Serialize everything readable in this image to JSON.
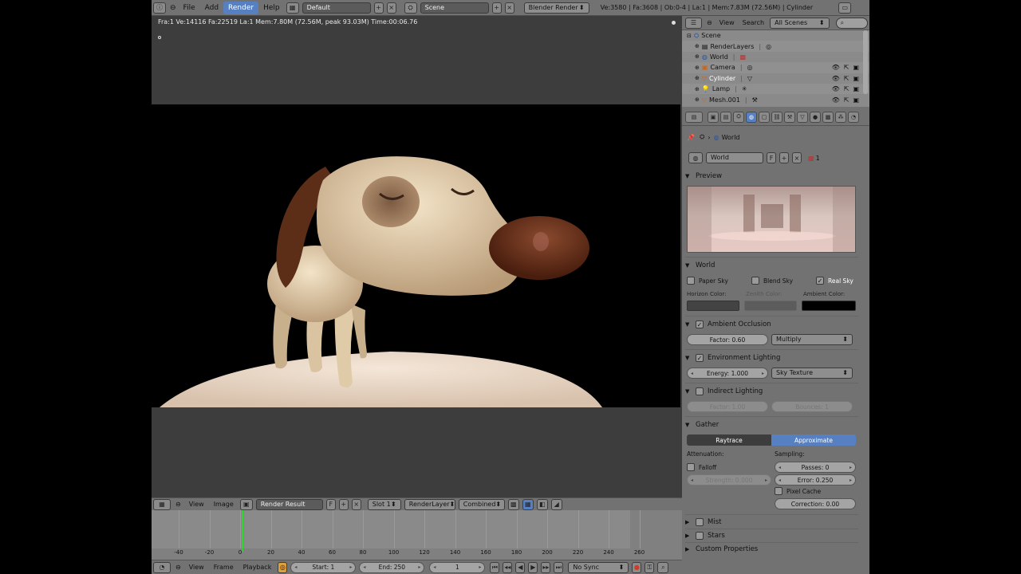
{
  "menu": {
    "file": "File",
    "add": "Add",
    "render": "Render",
    "help": "Help"
  },
  "screen_layout": "Default",
  "scene_name": "Scene",
  "render_engine": "Blender Render",
  "top_stats": "Ve:3580 | Fa:3608 | Ob:0-4 | La:1 | Mem:7.83M (72.56M) | Cylinder",
  "render_info": "Fra:1  Ve:14116 Fa:22519 La:1 Mem:7.80M (72.56M, peak 93.03M) Time:00:06.76",
  "image_header": {
    "view": "View",
    "image": "Image",
    "image_name": "Render Result",
    "fake_user": "F",
    "slot": "Slot 1",
    "layer": "RenderLayer",
    "pass": "Combined"
  },
  "timeline": {
    "ticks": [
      "-40",
      "-20",
      "0",
      "20",
      "40",
      "60",
      "80",
      "100",
      "120",
      "140",
      "160",
      "180",
      "200",
      "220",
      "240",
      "260"
    ],
    "current_frame_marker": 0,
    "view": "View",
    "frame": "Frame",
    "playback": "Playback",
    "start": "Start: 1",
    "end": "End: 250",
    "current": "1",
    "sync": "No Sync"
  },
  "outliner": {
    "view": "View",
    "search": "Search",
    "filter": "All Scenes",
    "rows": [
      {
        "label": "Scene",
        "icon": "scene-icon"
      },
      {
        "label": "RenderLayers",
        "icon": "renderlayers-icon"
      },
      {
        "label": "World",
        "icon": "world-icon"
      },
      {
        "label": "Camera",
        "icon": "camera-icon"
      },
      {
        "label": "Cylinder",
        "icon": "mesh-icon"
      },
      {
        "label": "Lamp",
        "icon": "lamp-icon"
      },
      {
        "label": "Mesh.001",
        "icon": "mesh-icon"
      }
    ]
  },
  "properties": {
    "breadcrumb": "World",
    "world_name": "World",
    "world_fake": "F",
    "world_users": "1",
    "preview_title": "Preview",
    "world_panel": {
      "title": "World",
      "paper_sky": "Paper Sky",
      "blend_sky": "Blend Sky",
      "real_sky": "Real Sky",
      "real_sky_checked": true,
      "horizon_label": "Horizon Color:",
      "zenith_label": "Zenith Color:",
      "ambient_label": "Ambient Color:",
      "horizon_color": "#434343",
      "zenith_color": "#5c5c5c",
      "ambient_color": "#000000"
    },
    "ao": {
      "title": "Ambient Occlusion",
      "factor": "Factor: 0.60",
      "blend": "Multiply"
    },
    "env": {
      "title": "Environment Lighting",
      "energy": "Energy: 1.000",
      "source": "Sky Texture"
    },
    "indirect": {
      "title": "Indirect Lighting",
      "factor": "Factor: 1.00",
      "bounces": "Bounces: 1"
    },
    "gather": {
      "title": "Gather",
      "raytrace": "Raytrace",
      "approximate": "Approximate",
      "attenuation": "Attenuation:",
      "sampling": "Sampling:",
      "falloff": "Falloff",
      "strength": "Strength: 0.000",
      "passes": "Passes: 0",
      "error": "Error: 0.250",
      "pixel_cache": "Pixel Cache",
      "correction": "Correction: 0.00"
    },
    "mist": "Mist",
    "stars": "Stars",
    "custom": "Custom Properties"
  }
}
